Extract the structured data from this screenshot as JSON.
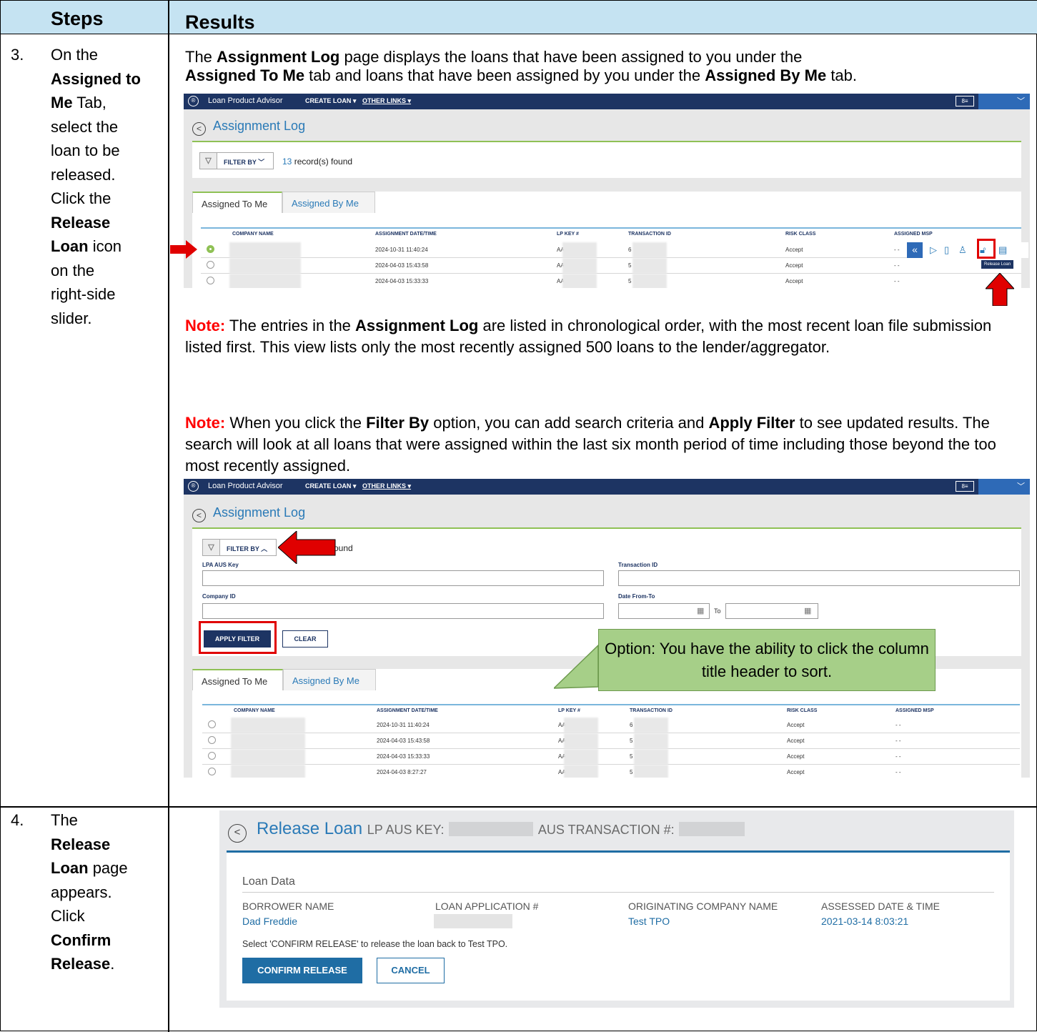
{
  "header": {
    "steps": "Steps",
    "results": "Results"
  },
  "step3": {
    "num": "3.",
    "lines": [
      "On the",
      "Assigned to",
      "Me Tab,",
      "select the",
      "loan to be",
      "released.",
      "Click the",
      "Release",
      "Loan icon",
      "on the",
      "right-side",
      "slider."
    ]
  },
  "step4": {
    "num": "4.",
    "lines": [
      "The",
      "Release",
      "Loan page",
      "appears.",
      "Click",
      "Confirm",
      "Release."
    ]
  },
  "intro": {
    "p1": "The ",
    "b1": "Assignment Log",
    "p2": " page displays the loans that have been assigned to you under the",
    "b2": "Assigned To Me",
    "p3": " tab and loans that have been assigned by you under the ",
    "b3": "Assigned By Me",
    "p4": " tab."
  },
  "note1": {
    "label": "Note:",
    "p1": "  The entries in the ",
    "b1": "Assignment Log",
    "p2": " are listed in chronological order, with the most recent loan file submission listed first. This view lists only the most recently assigned 500 loans to the lender/aggregator."
  },
  "note2": {
    "label": "Note:",
    "p1": " When you click the ",
    "b1": "Filter By",
    "p2": " option, you can add search criteria and ",
    "b2": "Apply Filter",
    "p3": " to see updated results. The search will look at all loans that were assigned within the last six month period of time including those beyond the too most recently assigned."
  },
  "app": {
    "product": "Loan Product Advisor",
    "create_loan": "CREATE LOAN",
    "other_links": "OTHER LINKS",
    "page_title": "Assignment Log",
    "filter_by": "FILTER BY",
    "record_count": "13",
    "record_suffix": " record(s) found",
    "record_suffix_partial": "ound",
    "tab_to_me": "Assigned To Me",
    "tab_by_me": "Assigned By Me",
    "tooltip": "Release Loan",
    "columns": [
      "COMPANY NAME",
      "ASSIGNMENT DATE/TIME",
      "LP KEY #",
      "TRANSACTION ID",
      "RISK CLASS",
      "ASSIGNED MSP"
    ],
    "rows": [
      {
        "date": "2024-10-31 11:40:24",
        "lpkey": "AA",
        "txn": "6",
        "risk": "Accept",
        "msp": "- -"
      },
      {
        "date": "2024-04-03 15:43:58",
        "lpkey": "AA",
        "txn": "5",
        "risk": "Accept",
        "msp": "- -"
      },
      {
        "date": "2024-04-03 15:33:33",
        "lpkey": "AA",
        "txn": "5",
        "risk": "Accept",
        "msp": "- -"
      },
      {
        "date": "2024-04-03 8:27:27",
        "lpkey": "AA",
        "txn": "5",
        "risk": "Accept",
        "msp": "- -"
      }
    ],
    "filter": {
      "lpa_aus_key": "LPA AUS Key",
      "transaction_id": "Transaction ID",
      "company_id": "Company ID",
      "date_from_to": "Date From-To",
      "to": "To",
      "apply": "APPLY FILTER",
      "clear": "CLEAR"
    }
  },
  "callout": "Option: You have the ability to click the column title header to sort.",
  "release": {
    "title": "Release Loan",
    "key_label": "LP AUS KEY:",
    "txn_label": "AUS TRANSACTION #:",
    "section": "Loan Data",
    "borrower_label": "BORROWER NAME",
    "borrower": "Dad Freddie",
    "loan_app_label": "LOAN APPLICATION #",
    "orig_label": "ORIGINATING COMPANY NAME",
    "orig": "Test TPO",
    "assessed_label": "ASSESSED DATE & TIME",
    "assessed": "2021-03-14 8:03:21",
    "message": "Select 'CONFIRM RELEASE' to release the loan back to Test TPO.",
    "confirm": "CONFIRM RELEASE",
    "cancel": "CANCEL"
  },
  "colors": {
    "header_bg": "#c5e3f2",
    "nav": "#1d3463",
    "accent": "#2a7ab7",
    "green": "#8fc155",
    "red": "#e00000",
    "callout": "#a6cf88"
  }
}
